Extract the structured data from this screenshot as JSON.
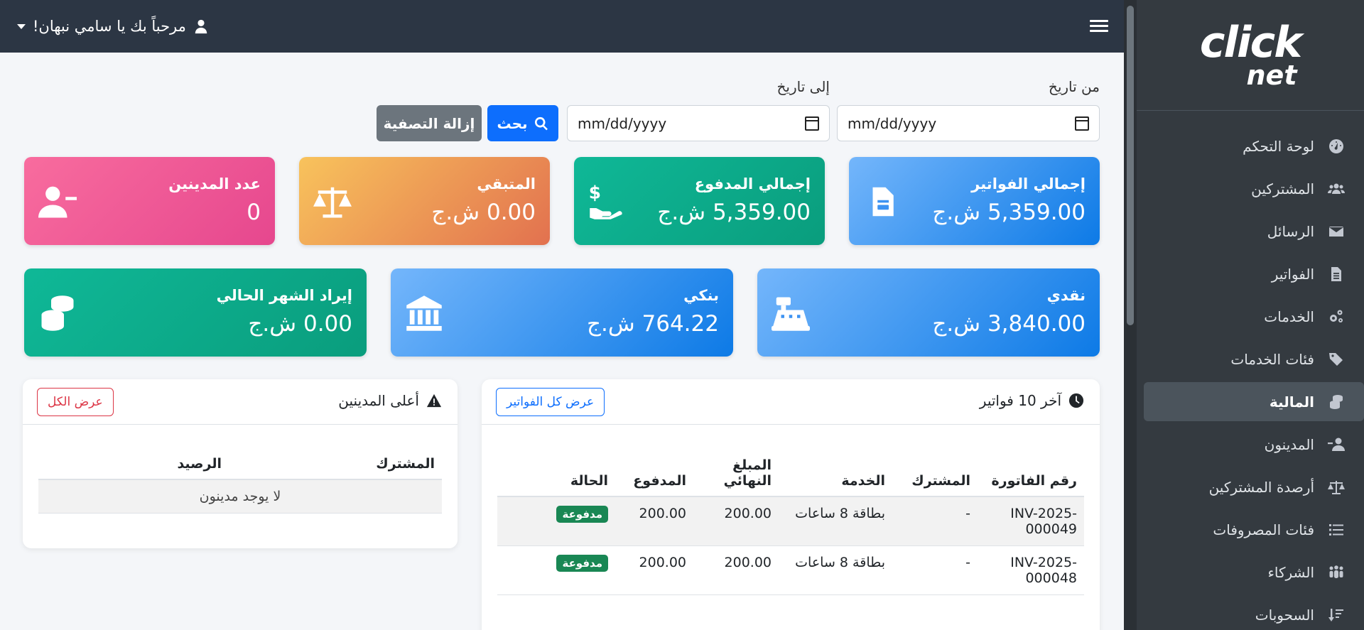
{
  "sidebar": {
    "brand_top": "click",
    "brand_bottom": "net",
    "items": [
      {
        "label": "لوحة التحكم",
        "icon": "dashboard-gauge-icon"
      },
      {
        "label": "المشتركين",
        "icon": "users-icon"
      },
      {
        "label": "الرسائل",
        "icon": "envelope-icon"
      },
      {
        "label": "الفواتير",
        "icon": "invoice-file-icon"
      },
      {
        "label": "الخدمات",
        "icon": "gears-icon"
      },
      {
        "label": "فئات الخدمات",
        "icon": "tags-icon"
      },
      {
        "label": "المالية",
        "icon": "coins-icon",
        "active": true
      },
      {
        "label": "المدينون",
        "icon": "user-minus-icon"
      },
      {
        "label": "أرصدة المشتركين",
        "icon": "scale-icon"
      },
      {
        "label": "فئات المصروفات",
        "icon": "list-icon"
      },
      {
        "label": "الشركاء",
        "icon": "partners-icon"
      },
      {
        "label": "السحوبات",
        "icon": "sort-down-icon"
      }
    ]
  },
  "topbar": {
    "welcome": "مرحباً بك يا سامي نبهان!"
  },
  "filter": {
    "from_label": "من تاريخ",
    "to_label": "إلى تاريخ",
    "from_placeholder": "mm/dd/yyyy",
    "to_placeholder": "mm/dd/yyyy",
    "search_label": "بحث",
    "clear_label": "إزالة التصفية"
  },
  "stats": {
    "total_invoices": {
      "label": "إجمالي الفواتير",
      "value": "5,359.00 ش.ج"
    },
    "total_paid": {
      "label": "إجمالي المدفوع",
      "value": "5,359.00 ش.ج"
    },
    "remaining": {
      "label": "المتبقي",
      "value": "0.00 ش.ج"
    },
    "debtors_count": {
      "label": "عدد المدينين",
      "value": "0"
    },
    "cash": {
      "label": "نقدي",
      "value": "3,840.00 ش.ج"
    },
    "bank": {
      "label": "بنكي",
      "value": "764.22 ش.ج"
    },
    "month_income": {
      "label": "إيراد الشهر الحالي",
      "value": "0.00 ش.ج"
    }
  },
  "latest_invoices": {
    "title": "آخر 10 فواتير",
    "view_all": "عرض كل الفواتير",
    "columns": [
      "رقم الفاتورة",
      "المشترك",
      "الخدمة",
      "المبلغ النهائي",
      "المدفوع",
      "الحالة"
    ],
    "rows": [
      {
        "number": "INV-2025-000049",
        "subscriber": "-",
        "service": "بطاقة 8 ساعات",
        "final": "200.00",
        "paid": "200.00",
        "status": "مدفوعة"
      },
      {
        "number": "INV-2025-000048",
        "subscriber": "-",
        "service": "بطاقة 8 ساعات",
        "final": "200.00",
        "paid": "200.00",
        "status": "مدفوعة"
      }
    ]
  },
  "top_debtors": {
    "title": "أعلى المدينين",
    "view_all": "عرض الكل",
    "columns": [
      "المشترك",
      "الرصيد"
    ],
    "empty": "لا يوجد مدينون"
  },
  "colors": {
    "sidebar_bg": "#343a40",
    "topbar_bg": "#2c3644",
    "primary": "#0d6efd",
    "success": "#198754",
    "danger": "#dc3545"
  }
}
